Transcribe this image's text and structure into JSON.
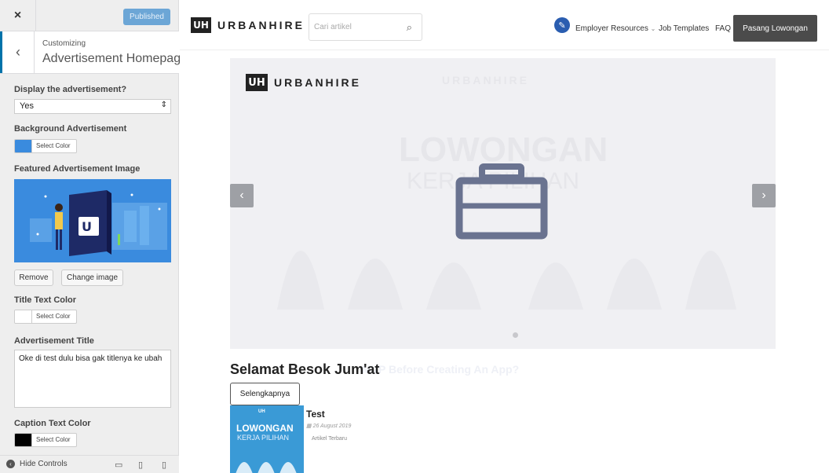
{
  "customizer": {
    "close_label": "×",
    "publish_label": "Published",
    "back_label": "‹",
    "subtitle": "Customizing",
    "title": "Advertisement Homepage",
    "display_label": "Display the advertisement?",
    "display_value": "Yes",
    "bg_label": "Background Advertisement",
    "bg_color": "#3a8bde",
    "select_color": "Select Color",
    "featured_label": "Featured Advertisement Image",
    "remove_label": "Remove",
    "change_label": "Change image",
    "title_color_label": "Title Text Color",
    "title_color": "#ffffff",
    "ad_title_label": "Advertisement Title",
    "ad_title_value": "Oke di test dulu bisa gak titlenya ke ubah",
    "caption_color_label": "Caption Text Color",
    "caption_color": "#000000",
    "hide_controls": "Hide Controls"
  },
  "site": {
    "logo_mark": "UH",
    "logo_word": "URBANHIRE",
    "search_placeholder": "Cari artikel",
    "nav": {
      "employer": "Employer Resources",
      "templates": "Job Templates",
      "faq": "FAQ",
      "cta": "Pasang Lowongan"
    },
    "hero": {
      "logo_word": "URBANHIRE",
      "ghost_line1": "LOWONGAN",
      "ghost_line2": "KERJA PILIHAN",
      "prev": "‹",
      "next": "›"
    },
    "caption_title": "Selamat Besok Jum'at",
    "caption_ghost": "MVP Before Creating An App?",
    "more_label": "Selengkapnya",
    "article": {
      "thumb_l1": "LOWONGAN",
      "thumb_l2": "KERJA PILIHAN",
      "title": "Test",
      "date": "26 August 2019",
      "category": "Artikel Terbaru"
    }
  }
}
